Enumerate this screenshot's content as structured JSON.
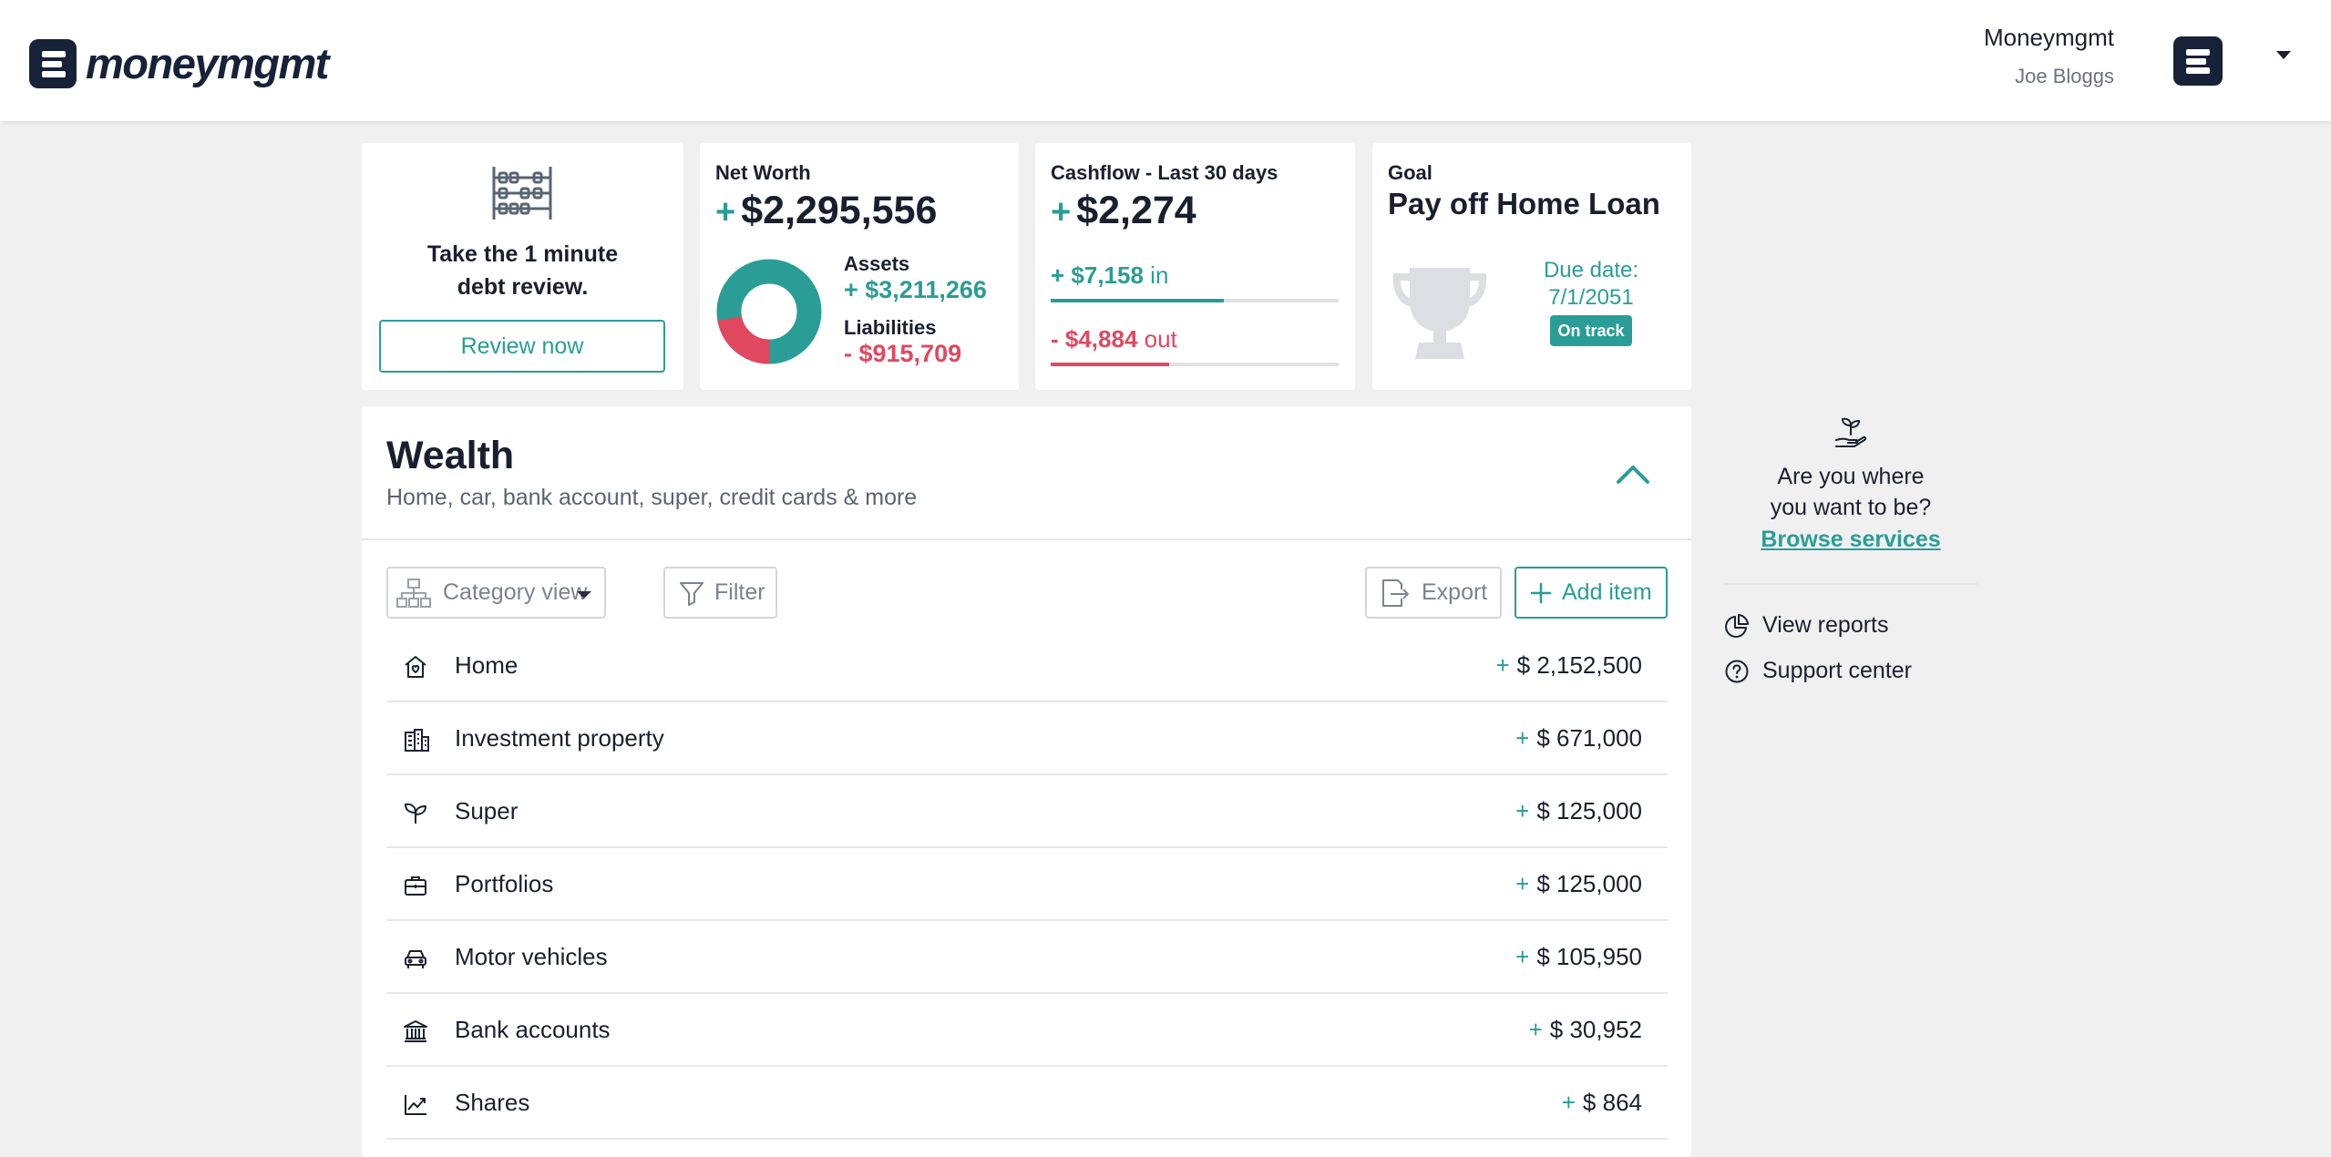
{
  "header": {
    "logo_text": "moneymgmt",
    "org_name": "Moneymgmt",
    "user_name": "Joe Bloggs"
  },
  "review_card": {
    "text_line1": "Take the 1 minute",
    "text_line2": "debt review.",
    "button_label": "Review now"
  },
  "net_worth": {
    "label": "Net Worth",
    "sign": "+",
    "amount": "$2,295,556",
    "assets_label": "Assets",
    "assets_value": "+ $3,211,266",
    "liabilities_label": "Liabilities",
    "liabilities_value": "- $915,709",
    "assets_share": 0.778
  },
  "cashflow": {
    "label": "Cashflow - Last 30 days",
    "sign": "+",
    "amount": "$2,274",
    "in_value": "+ $7,158",
    "in_label": "in",
    "in_fill": 0.6,
    "out_value": "- $4,884",
    "out_label": "out",
    "out_fill": 0.41
  },
  "goal": {
    "label": "Goal",
    "title": "Pay off Home Loan",
    "due_label": "Due date:",
    "due_date": "7/1/2051",
    "status": "On track"
  },
  "wealth": {
    "title": "Wealth",
    "subtitle": "Home, car, bank account, super, credit cards & more",
    "category_view_label": "Category view",
    "filter_label": "Filter",
    "export_label": "Export",
    "add_item_label": "Add item",
    "items": [
      {
        "label": "Home",
        "sign": "+",
        "value": "$ 2,152,500",
        "icon": "home-icon"
      },
      {
        "label": "Investment property",
        "sign": "+",
        "value": "$ 671,000",
        "icon": "buildings-icon"
      },
      {
        "label": "Super",
        "sign": "+",
        "value": "$ 125,000",
        "icon": "sprout-icon"
      },
      {
        "label": "Portfolios",
        "sign": "+",
        "value": "$ 125,000",
        "icon": "briefcase-icon"
      },
      {
        "label": "Motor vehicles",
        "sign": "+",
        "value": "$ 105,950",
        "icon": "car-icon"
      },
      {
        "label": "Bank accounts",
        "sign": "+",
        "value": "$ 30,952",
        "icon": "bank-icon"
      },
      {
        "label": "Shares",
        "sign": "+",
        "value": "$ 864",
        "icon": "chart-trend-icon"
      }
    ]
  },
  "sidebar": {
    "promo_line1": "Are you where",
    "promo_line2": "you want to be?",
    "browse_label": "Browse services",
    "view_reports_label": "View reports",
    "support_label": "Support center"
  },
  "colors": {
    "accent": "#2a9d96",
    "negative": "#e0485f",
    "brand": "#172238"
  }
}
